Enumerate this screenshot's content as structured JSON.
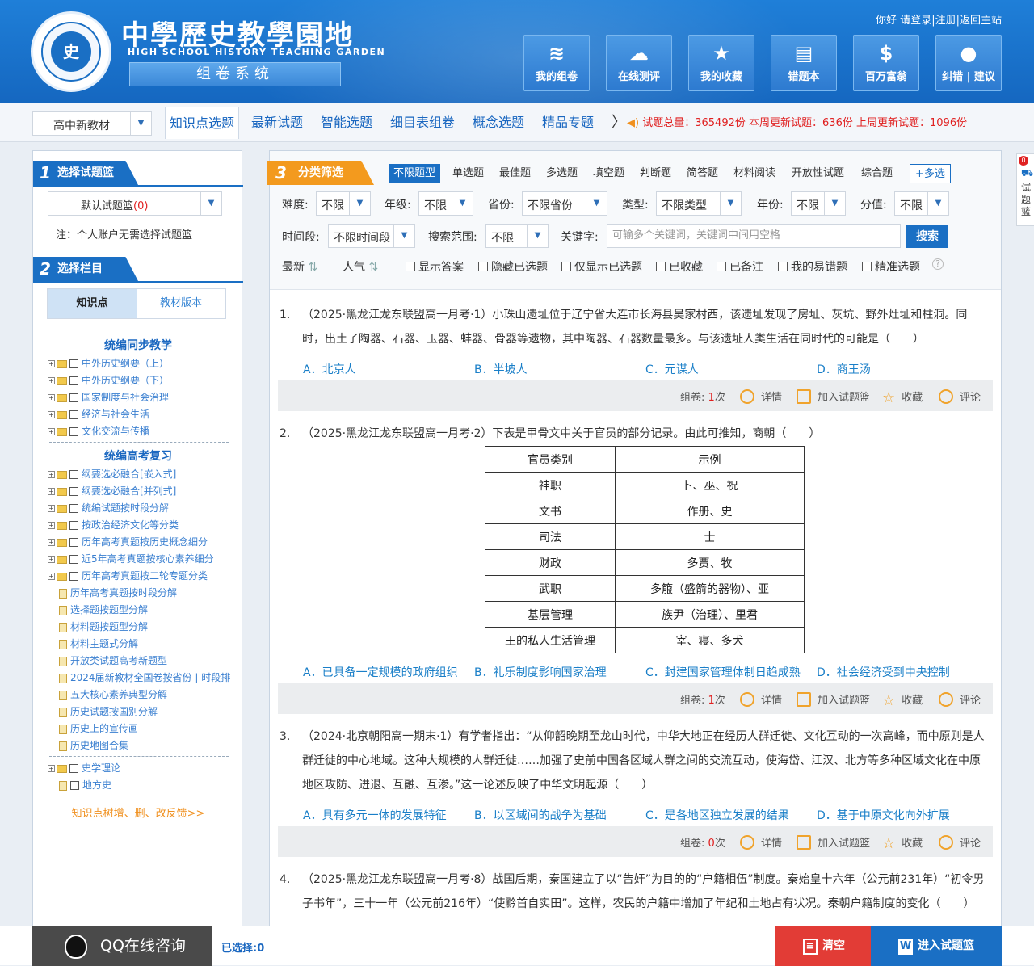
{
  "header": {
    "logo_mark": "史",
    "title": "中學歷史教學園地",
    "subtitle_en": "HIGH SCHOOL HISTORY TEACHING GARDEN",
    "system_name": "组卷系统",
    "greeting": "你好",
    "login": "请登录",
    "register": "注册",
    "back_home": "返回主站",
    "sep": "|",
    "nav": [
      {
        "label": "我的组卷",
        "icon": "layers-icon",
        "glyph": "≋"
      },
      {
        "label": "在线测评",
        "icon": "cloud-chart-icon",
        "glyph": "☁"
      },
      {
        "label": "我的收藏",
        "icon": "star-icon",
        "glyph": "★"
      },
      {
        "label": "错题本",
        "icon": "notebook-icon",
        "glyph": "▤"
      },
      {
        "label": "百万富翁",
        "icon": "money-bag-icon",
        "glyph": "$"
      },
      {
        "label": "纠错 | 建议",
        "icon": "user-icon",
        "glyph": "●"
      }
    ]
  },
  "tabbar": {
    "textbook_select": "高中新教材",
    "tabs": [
      "知识点选题",
      "最新试题",
      "智能选题",
      "细目表组卷",
      "概念选题",
      "精品专题"
    ],
    "more_arrow": "〉",
    "stats": {
      "total_label": "试题总量：",
      "total": "365492份",
      "week_label": "本周更新试题：",
      "week": "636份",
      "lastweek_label": "上周更新试题：",
      "lastweek": "1096份"
    }
  },
  "left": {
    "step1_no": "1",
    "step1_label": "选择试题篮",
    "basket_name": "默认试题篮",
    "basket_count": "(0)",
    "note": "注：个人账户无需选择试题篮",
    "step2_no": "2",
    "step2_label": "选择栏目",
    "switch_tabs": [
      "知识点",
      "教材版本"
    ],
    "group1_title": "统编同步教学",
    "group1": [
      "中外历史纲要（上）",
      "中外历史纲要（下）",
      "国家制度与社会治理",
      "经济与社会生活",
      "文化交流与传播"
    ],
    "group2_title": "统编高考复习",
    "group2_folders": [
      "纲要选必融合[嵌入式]",
      "纲要选必融合[并列式]",
      "统编试题按时段分解",
      "按政治经济文化等分类",
      "历年高考真题按历史概念细分",
      "近5年高考真题按核心素养细分",
      "历年高考真题按二轮专题分类"
    ],
    "group2_docs": [
      "历年高考真题按时段分解",
      "选择题按题型分解",
      "材料题按题型分解",
      "材料主题式分解",
      "开放类试题高考新题型",
      "2024届新教材全国卷按省份 | 时段排列",
      "五大核心素养典型分解",
      "历史试题按国别分解",
      "历史上的宣传画",
      "历史地图合集"
    ],
    "group3": [
      "史学理论",
      "地方史"
    ],
    "feedback": "知识点树增、删、改反馈>>"
  },
  "filter": {
    "step3_no": "3",
    "step3_label": "分类筛选",
    "types": [
      "不限题型",
      "单选题",
      "最佳题",
      "多选题",
      "填空题",
      "判断题",
      "简答题",
      "材料阅读",
      "开放性试题",
      "综合题"
    ],
    "multi": "+多选",
    "difficulty_label": "难度:",
    "difficulty": "不限",
    "grade_label": "年级:",
    "grade": "不限",
    "province_label": "省份:",
    "province": "不限省份",
    "type_label": "类型:",
    "type": "不限类型",
    "year_label": "年份:",
    "year": "不限",
    "score_label": "分值:",
    "score": "不限",
    "period_label": "时间段:",
    "period": "不限时间段",
    "range_label": "搜索范围:",
    "range": "不限",
    "keyword_label": "关键字:",
    "keyword_placeholder": "可输多个关键词，关键词中间用空格",
    "search": "搜索",
    "sort_new": "最新",
    "sort_hot": "人气",
    "checks": [
      "显示答案",
      "隐藏已选题",
      "仅显示已选题",
      "已收藏",
      "已备注",
      "我的易错题",
      "精准选题"
    ],
    "help": "?"
  },
  "bar": {
    "compose_label": "组卷:",
    "times_suffix": "次",
    "detail": "详情",
    "add": "加入试题篮",
    "fav": "收藏",
    "comment": "评论"
  },
  "questions": [
    {
      "no": "1.",
      "stem": "（2025·黑龙江龙东联盟高一月考·1）小珠山遗址位于辽宁省大连市长海县吴家村西，该遗址发现了房址、灰坑、野外灶址和柱洞。同时，出土了陶器、石器、玉器、蚌器、骨器等遗物，其中陶器、石器数量最多。与该遗址人类生活在同时代的可能是（　　）",
      "options": [
        "A．北京人",
        "B．半坡人",
        "C．元谋人",
        "D．商王汤"
      ],
      "count": "1"
    },
    {
      "no": "2.",
      "stem": "（2025·黑龙江龙东联盟高一月考·2）下表是甲骨文中关于官员的部分记录。由此可推知，商朝（　　）",
      "table": [
        [
          "官员类别",
          "示例"
        ],
        [
          "神职",
          "卜、巫、祝"
        ],
        [
          "文书",
          "作册、史"
        ],
        [
          "司法",
          "士"
        ],
        [
          "财政",
          "多贾、牧"
        ],
        [
          "武职",
          "多箙（盛箭的器物）、亚"
        ],
        [
          "基层管理",
          "族尹（治理）、里君"
        ],
        [
          "王的私人生活管理",
          "宰、寝、多犬"
        ]
      ],
      "options": [
        "A．已具备一定规模的政府组织",
        "B．礼乐制度影响国家治理",
        "C．封建国家管理体制日趋成熟",
        "D．社会经济受到中央控制"
      ],
      "count": "1"
    },
    {
      "no": "3.",
      "stem": "（2024·北京朝阳高一期末·1）有学者指出：“从仰韶晚期至龙山时代，中华大地正在经历人群迁徙、文化互动的一次高峰，而中原则是人群迁徙的中心地域。这种大规模的人群迁徙……加强了史前中国各区域人群之间的交流互动，使海岱、江汉、北方等多种区域文化在中原地区攻防、进退、互融、互渗。”这一论述反映了中华文明起源（　　）",
      "options": [
        "A．具有多元一体的发展特征",
        "B．以区域间的战争为基础",
        "C．是各地区独立发展的结果",
        "D．基于中原文化向外扩展"
      ],
      "count": "0"
    },
    {
      "no": "4.",
      "stem": "（2025·黑龙江龙东联盟高一月考·8）战国后期，秦国建立了以“告奸”为目的的“户籍相伍”制度。秦始皇十六年（公元前231年）“初令男子书年”，三十一年（公元前216年）“使黔首自实田”。这样，农民的户籍中增加了年纪和土地占有状况。秦朝户籍制度的变化（　　）"
    }
  ],
  "right_tab": {
    "badge": "0",
    "label": "试题篮"
  },
  "bottom": {
    "qq": "QQ在线咨询",
    "selected": "已选择:0",
    "clear": "清空",
    "enter": "进入试题篮",
    "word_glyph": "W"
  }
}
